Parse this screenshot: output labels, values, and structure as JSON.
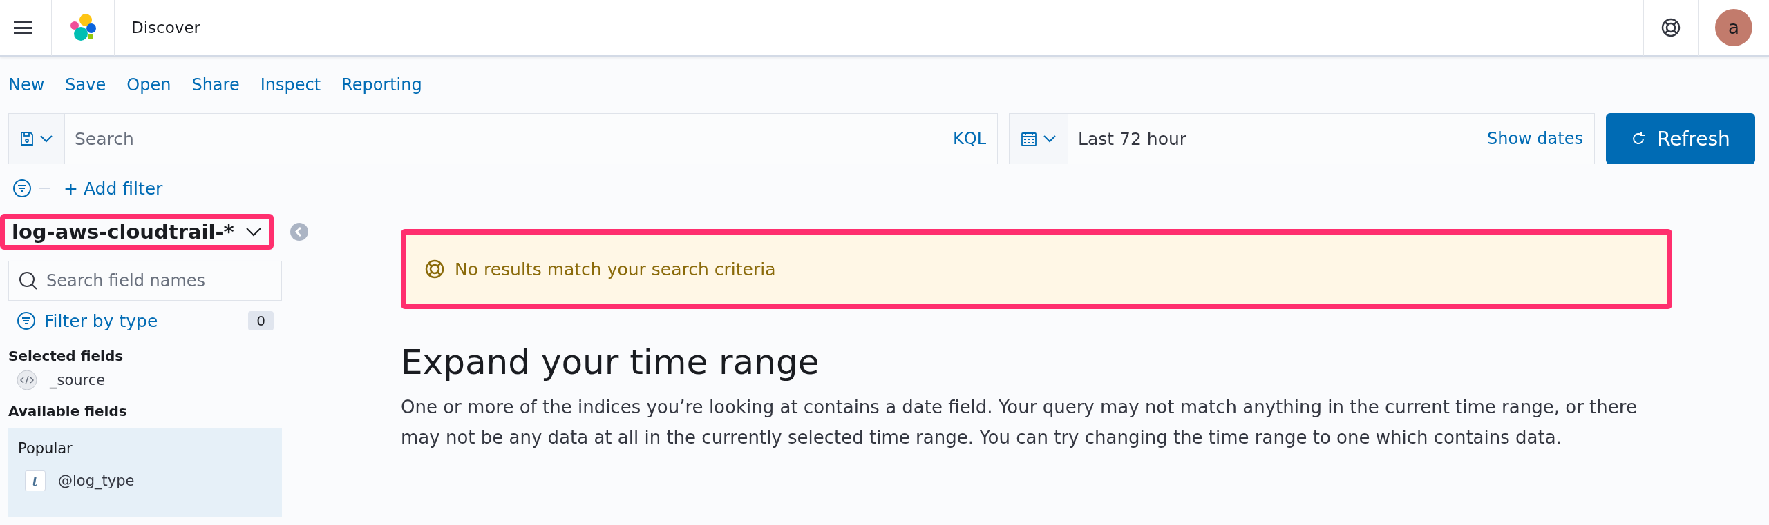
{
  "header": {
    "title": "Discover",
    "avatar": "a"
  },
  "top_menu": [
    "New",
    "Save",
    "Open",
    "Share",
    "Inspect",
    "Reporting"
  ],
  "query_bar": {
    "placeholder": "Search",
    "language": "KQL"
  },
  "time_picker": {
    "value": "Last 72 hour",
    "show_dates": "Show dates"
  },
  "refresh_button": "Refresh",
  "filter_bar": {
    "add_filter": "+ Add filter"
  },
  "sidebar": {
    "index_pattern": {
      "label": "log-aws-cloudtrail-*",
      "highlighted": true
    },
    "search": {
      "placeholder": "Search field names"
    },
    "filter_by_type": {
      "label": "Filter by type",
      "count": "0"
    },
    "selected_title": "Selected fields",
    "selected_fields": [
      {
        "name": "_source",
        "kind": "source"
      }
    ],
    "available_title": "Available fields",
    "popular_title": "Popular",
    "popular_fields": [
      {
        "name": "@log_type",
        "kind": "string",
        "type_icon": "t"
      }
    ]
  },
  "callout": {
    "text": "No results match your search criteria",
    "highlighted": true
  },
  "empty_state": {
    "title": "Expand your time range",
    "body": "One or more of the indices you’re looking at contains a date field. Your query may not match anything in the current time range, or there may not be any data at all in the currently selected time range. You can try changing the time range to one which contains data."
  }
}
